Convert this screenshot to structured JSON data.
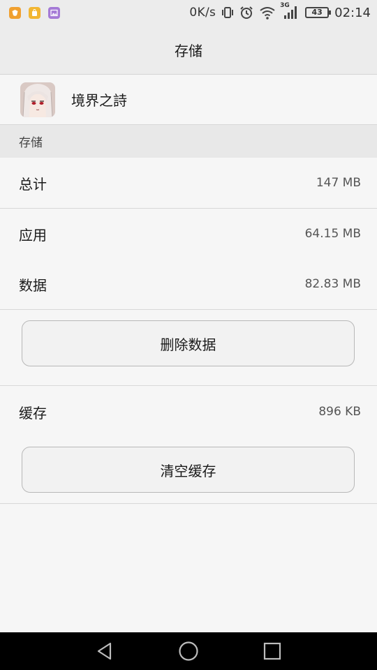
{
  "status_bar": {
    "net_speed": "0K/s",
    "network_type": "3G",
    "battery_level": "43",
    "time": "02:14",
    "notification_icons": [
      "shield-app-icon",
      "store-app-icon",
      "gallery-app-icon"
    ],
    "notification_colors": [
      "#f0a030",
      "#f2b632",
      "#a57ad6"
    ]
  },
  "header": {
    "title": "存储"
  },
  "app": {
    "name": "境界之詩",
    "icon": "anime-character-avatar"
  },
  "section": {
    "title": "存储"
  },
  "storage": {
    "total": {
      "label": "总计",
      "value": "147 MB"
    },
    "app": {
      "label": "应用",
      "value": "64.15 MB"
    },
    "data": {
      "label": "数据",
      "value": "82.83 MB"
    },
    "clear_data_button": "删除数据",
    "cache": {
      "label": "缓存",
      "value": "896 KB"
    },
    "clear_cache_button": "清空缓存"
  },
  "nav": {
    "back": "back-icon",
    "home": "home-icon",
    "recent": "recent-apps-icon"
  }
}
